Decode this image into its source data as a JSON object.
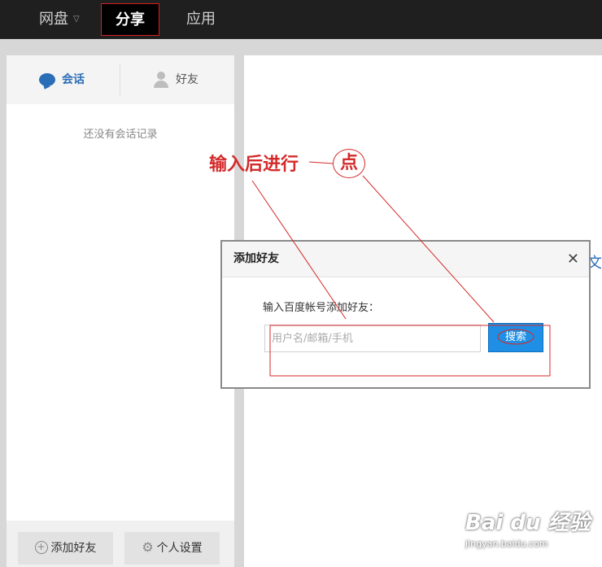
{
  "nav": {
    "items": [
      "网盘",
      "分享",
      "应用"
    ],
    "active": "分享"
  },
  "left": {
    "tabs": {
      "chat": "会话",
      "friends": "好友"
    },
    "empty_text": "还没有会话记录",
    "buttons": {
      "add_friend": "添加好友",
      "settings": "个人设置"
    }
  },
  "right": {
    "cut_text": "文"
  },
  "dialog": {
    "title": "添加好友",
    "close": "✕",
    "label": "输入百度帐号添加好友：",
    "input_value": "",
    "input_placeholder": "用户名/邮箱/手机",
    "search_label": "搜索"
  },
  "annotation": {
    "text": "输入后进行",
    "circle_text": "点",
    "color": "#d42a2a"
  },
  "watermark": {
    "brand": "Bai du 经验",
    "url": "jingyan.baidu.com"
  }
}
